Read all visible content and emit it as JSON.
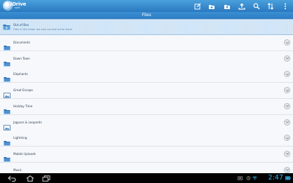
{
  "app": {
    "logo_text": "iDrive",
    "logo_sub": "sync"
  },
  "toolbar": {
    "icons": [
      "edit-icon",
      "new-folder-icon",
      "upload-folder-icon",
      "upload-icon",
      "search-icon",
      "sort-icon",
      "overflow-menu-icon"
    ]
  },
  "title": "Files",
  "banner": {
    "title": "Out of Box",
    "subtitle": "Files in this folder are only synced to the cloud"
  },
  "files": [
    {
      "name": "Documents",
      "icon": "folder-icon"
    },
    {
      "name": "Down Town",
      "icon": "folder-icon"
    },
    {
      "name": "Elephants",
      "icon": "folder-icon"
    },
    {
      "name": "Great Escape",
      "icon": "image-folder-icon"
    },
    {
      "name": "Holiday Time",
      "icon": "folder-icon"
    },
    {
      "name": "Jaguars & Leopards",
      "icon": "image-folder-icon"
    },
    {
      "name": "Lightning",
      "icon": "folder-icon"
    },
    {
      "name": "Mobile Uploads",
      "icon": "folder-icon"
    },
    {
      "name": "Music",
      "icon": "folder-icon"
    }
  ],
  "system": {
    "time": "2:47",
    "accent": "#35b6f1"
  }
}
